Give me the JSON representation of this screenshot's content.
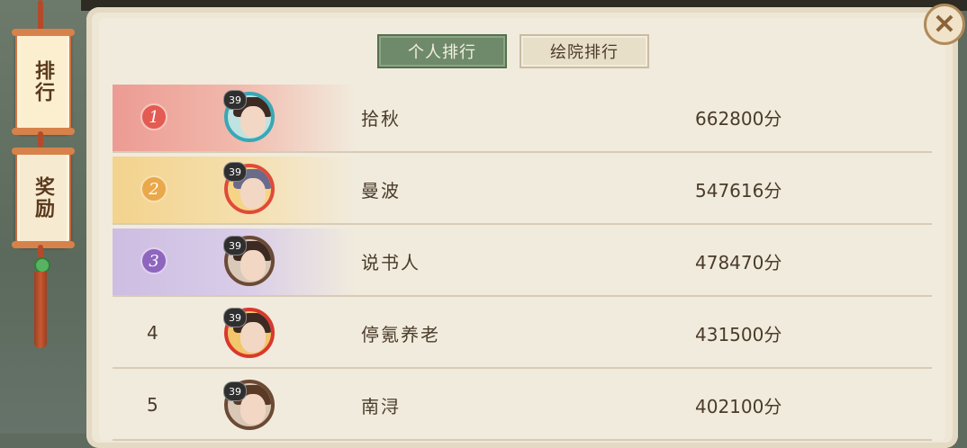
{
  "side_tabs": [
    {
      "label": "排行",
      "active": true
    },
    {
      "label": "奖励",
      "active": false
    }
  ],
  "tabs": [
    {
      "label": "个人排行",
      "active": true
    },
    {
      "label": "绘院排行",
      "active": false
    }
  ],
  "close_glyph": "✕",
  "rows": [
    {
      "rank": "1",
      "level": "39",
      "name": "拾秋",
      "score": "662800",
      "unit": "分"
    },
    {
      "rank": "2",
      "level": "39",
      "name": "曼波",
      "score": "547616",
      "unit": "分"
    },
    {
      "rank": "3",
      "level": "39",
      "name": "说书人",
      "score": "478470",
      "unit": "分"
    },
    {
      "rank": "4",
      "level": "39",
      "name": "停氪养老",
      "score": "431500",
      "unit": "分"
    },
    {
      "rank": "5",
      "level": "39",
      "name": "南浔",
      "score": "402100",
      "unit": "分"
    }
  ],
  "colors": {
    "rank1": "#e35b53",
    "rank2": "#e9a84a",
    "rank3": "#8e66be",
    "active_tab": "#6f8a6a"
  },
  "icons": [
    "close-icon",
    "avatar-portrait"
  ]
}
